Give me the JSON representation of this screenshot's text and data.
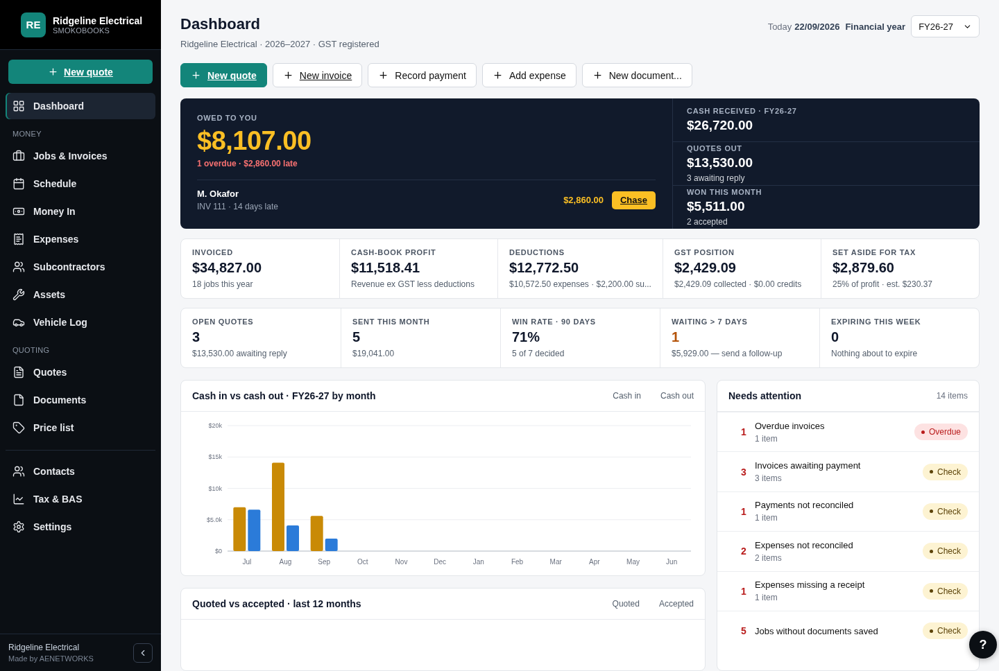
{
  "brand": {
    "initials": "RE",
    "name": "Ridgeline Electrical",
    "product": "SMOKOBOOKS"
  },
  "sidebar": {
    "cta": "New quote",
    "groups": [
      {
        "items": [
          {
            "label": "Dashboard",
            "selected": true
          }
        ]
      },
      {
        "heading": "MONEY",
        "items": [
          {
            "label": "Jobs & Invoices",
            "selected": false
          },
          {
            "label": "Schedule",
            "selected": false
          },
          {
            "label": "Money In",
            "selected": false
          },
          {
            "label": "Expenses",
            "selected": false
          },
          {
            "label": "Subcontractors",
            "selected": false
          },
          {
            "label": "Assets",
            "selected": false
          },
          {
            "label": "Vehicle Log",
            "selected": false
          }
        ]
      },
      {
        "heading": "QUOTING",
        "items": [
          {
            "label": "Quotes",
            "selected": false
          },
          {
            "label": "Documents",
            "selected": false
          },
          {
            "label": "Price list",
            "selected": false
          }
        ]
      },
      {
        "items": [
          {
            "label": "Contacts",
            "selected": false
          },
          {
            "label": "Tax & BAS",
            "selected": false
          },
          {
            "label": "Settings",
            "selected": false
          }
        ]
      }
    ],
    "footer": {
      "name": "Ridgeline Electrical",
      "credit": "Made by AENETWORKS"
    }
  },
  "header": {
    "title": "Dashboard",
    "subtitle": "Ridgeline Electrical · 2026–2027 · GST registered",
    "today_label": "Today",
    "today": "22/09/2026",
    "fy_label": "Financial year",
    "fy_value": "FY26-27"
  },
  "actions": [
    {
      "label": "New quote",
      "kind": "primary"
    },
    {
      "label": "New invoice",
      "kind": "link"
    },
    {
      "label": "Record payment",
      "kind": "plain"
    },
    {
      "label": "Add expense",
      "kind": "plain"
    },
    {
      "label": "New document...",
      "kind": "plain"
    }
  ],
  "hero": {
    "label": "OWED TO YOU",
    "amount": "$8,107.00",
    "note": "1 overdue · $2,860.00 late",
    "overdue": {
      "client": "M. Okafor",
      "detail": "INV 111 · 14 days late",
      "amount": "$2,860.00",
      "action": "Chase"
    },
    "side": [
      {
        "label": "CASH RECEIVED · FY26-27",
        "value": "$26,720.00"
      },
      {
        "label": "QUOTES OUT",
        "value": "$13,530.00",
        "sub": "3 awaiting reply"
      },
      {
        "label": "WON THIS MONTH",
        "value": "$5,511.00",
        "sub": "2 accepted"
      }
    ]
  },
  "stat_rows": [
    [
      {
        "label": "INVOICED",
        "value": "$34,827.00",
        "sub": "18 jobs this year",
        "highlight": false
      },
      {
        "label": "CASH-BOOK PROFIT",
        "value": "$11,518.41",
        "sub": "Revenue ex GST less deductions",
        "highlight": false
      },
      {
        "label": "DEDUCTIONS",
        "value": "$12,772.50",
        "sub": "$10,572.50 expenses · $2,200.00 su...",
        "highlight": false
      },
      {
        "label": "GST POSITION",
        "value": "$2,429.09",
        "sub": "$2,429.09 collected · $0.00 credits",
        "highlight": false
      },
      {
        "label": "SET ASIDE FOR TAX",
        "value": "$2,879.60",
        "sub": "25% of profit · est. $230.37",
        "highlight": false
      }
    ],
    [
      {
        "label": "OPEN QUOTES",
        "value": "3",
        "sub": "$13,530.00 awaiting reply",
        "highlight": false
      },
      {
        "label": "SENT THIS MONTH",
        "value": "5",
        "sub": "$19,041.00",
        "highlight": false
      },
      {
        "label": "WIN RATE · 90 DAYS",
        "value": "71%",
        "sub": "5 of 7 decided",
        "highlight": false
      },
      {
        "label": "WAITING > 7 DAYS",
        "value": "1",
        "sub": "$5,929.00 — send a follow-up",
        "highlight": true
      },
      {
        "label": "EXPIRING THIS WEEK",
        "value": "0",
        "sub": "Nothing about to expire",
        "highlight": false
      }
    ]
  ],
  "cash_chart": {
    "title": "Cash in vs cash out · FY26-27 by month",
    "chart_data": {
      "type": "bar",
      "grid": true,
      "categories": [
        "Jul",
        "Aug",
        "Sep",
        "Oct",
        "Nov",
        "Dec",
        "Jan",
        "Feb",
        "Mar",
        "Apr",
        "May",
        "Jun"
      ],
      "series": [
        {
          "name": "Cash in",
          "color": "#c98a06",
          "values": [
            7000,
            14100,
            5600,
            0,
            0,
            0,
            0,
            0,
            0,
            0,
            0,
            0
          ]
        },
        {
          "name": "Cash out",
          "color": "#2b7bd9",
          "values": [
            6600,
            4100,
            2000,
            0,
            0,
            0,
            0,
            0,
            0,
            0,
            0,
            0
          ]
        }
      ],
      "ylim": [
        0,
        20000
      ],
      "yticks": [
        {
          "value": 0,
          "label": "$0"
        },
        {
          "value": 5000,
          "label": "$5.0k"
        },
        {
          "value": 10000,
          "label": "$10k"
        },
        {
          "value": 15000,
          "label": "$15k"
        },
        {
          "value": 20000,
          "label": "$20k"
        }
      ]
    }
  },
  "quote_chart": {
    "title": "Quoted vs accepted · last 12 months",
    "legend": [
      "Quoted",
      "Accepted"
    ]
  },
  "attention": {
    "title": "Needs attention",
    "count": "14 items",
    "items": [
      {
        "count": "1",
        "title": "Overdue invoices",
        "sub": "1 item",
        "badge": "Overdue",
        "kind": "overdue"
      },
      {
        "count": "3",
        "title": "Invoices awaiting payment",
        "sub": "3 items",
        "badge": "Check",
        "kind": "check"
      },
      {
        "count": "1",
        "title": "Payments not reconciled",
        "sub": "1 item",
        "badge": "Check",
        "kind": "check"
      },
      {
        "count": "2",
        "title": "Expenses not reconciled",
        "sub": "2 items",
        "badge": "Check",
        "kind": "check"
      },
      {
        "count": "1",
        "title": "Expenses missing a receipt",
        "sub": "1 item",
        "badge": "Check",
        "kind": "check"
      },
      {
        "count": "5",
        "title": "Jobs without documents saved",
        "badge": "Check",
        "kind": "check"
      }
    ]
  },
  "help": "?"
}
